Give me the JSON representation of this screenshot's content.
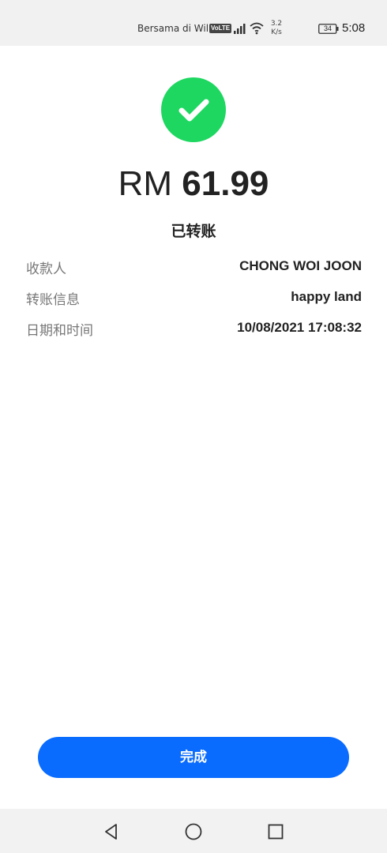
{
  "status_bar": {
    "carrier": "Bersama di Wil...",
    "volte": "VoLTE",
    "speed_value": "3.2",
    "speed_unit": "K/s",
    "battery": "34",
    "time": "5:08"
  },
  "receipt": {
    "currency": "RM",
    "amount": "61.99",
    "status": "已转账",
    "rows": [
      {
        "label": "收款人",
        "value": "CHONG WOI JOON"
      },
      {
        "label": "转账信息",
        "value": "happy land"
      },
      {
        "label": "日期和时间",
        "value": "10/08/2021 17:08:32"
      }
    ]
  },
  "actions": {
    "done_label": "完成"
  },
  "colors": {
    "success": "#1ed760",
    "primary": "#0a6cff"
  },
  "icons": [
    "checkmark-icon",
    "signal-icon",
    "wifi-icon",
    "battery-icon",
    "back-icon",
    "home-icon",
    "recent-apps-icon"
  ]
}
